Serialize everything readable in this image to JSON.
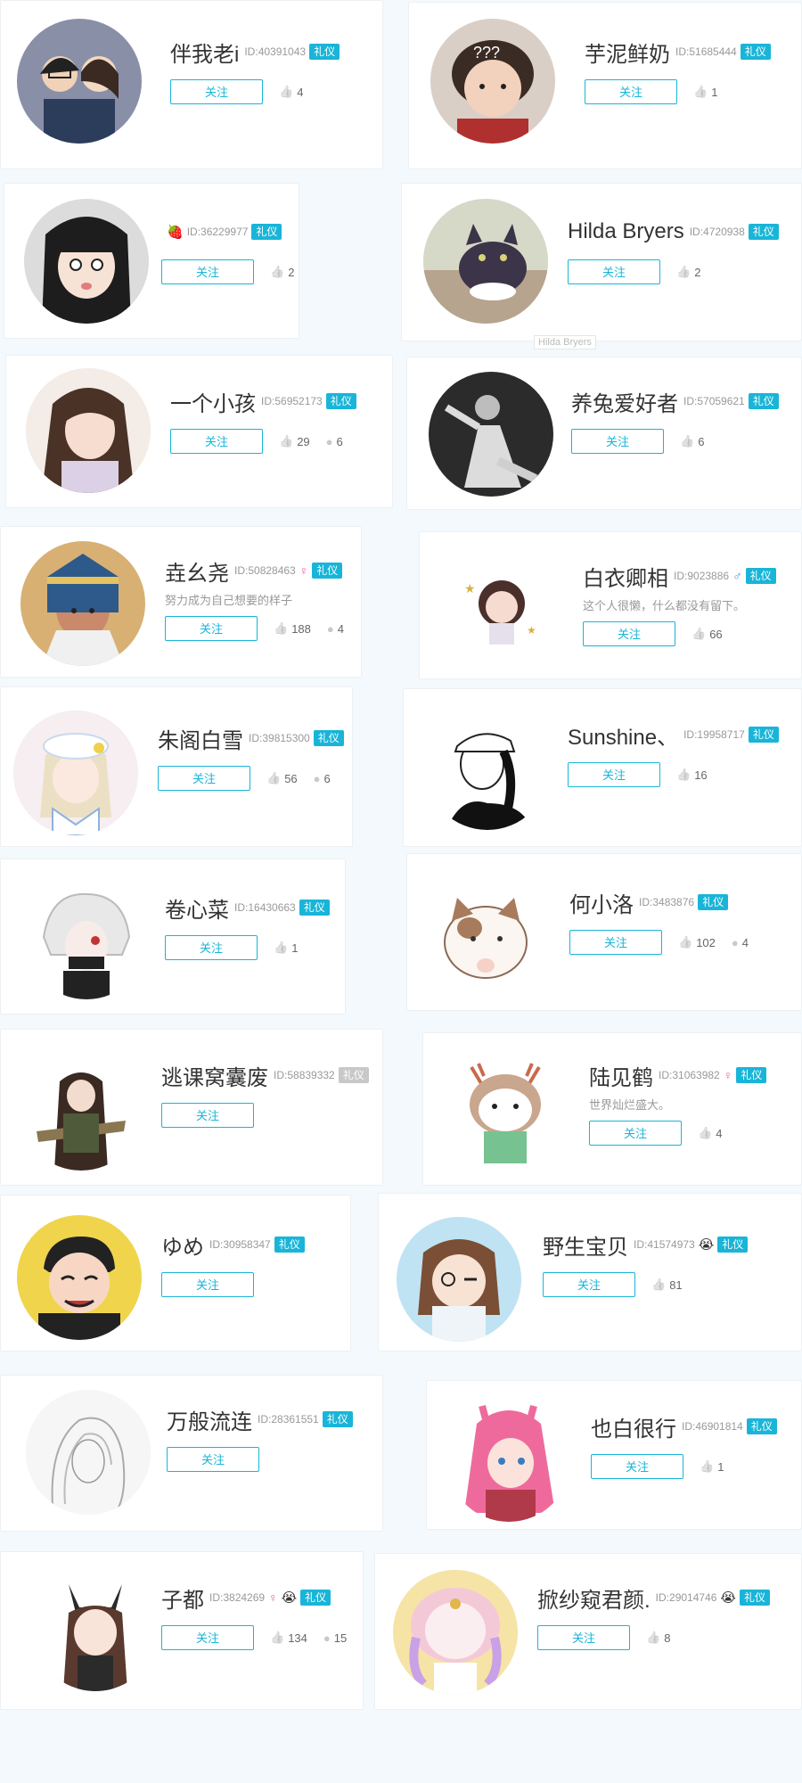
{
  "labels": {
    "follow": "关注",
    "id_prefix": "ID:"
  },
  "colors": {
    "accent": "#19b5d8",
    "badge_disabled": "#c8c8c8",
    "female": "#f15b9b",
    "male": "#3b8ee0"
  },
  "users": [
    {
      "name": "伴我老i",
      "id": "40391043",
      "badge": "礼仪",
      "likes": "4",
      "comments": null,
      "motto": null,
      "gender": null,
      "emoji": null,
      "avatar": "photo-couple"
    },
    {
      "name": "芋泥鲜奶",
      "id": "51685444",
      "badge": "礼仪",
      "likes": "1",
      "comments": null,
      "motto": null,
      "gender": null,
      "emoji": null,
      "avatar": "photo-baby"
    },
    {
      "name": "",
      "id": "36229977",
      "badge": "礼仪",
      "likes": "2",
      "comments": null,
      "motto": null,
      "gender": null,
      "emoji": "🍓",
      "avatar": "anime-black-hair"
    },
    {
      "name": "Hilda Bryers",
      "id": "4720938",
      "badge": "礼仪",
      "likes": "2",
      "comments": null,
      "motto": null,
      "gender": null,
      "emoji": null,
      "avatar": "photo-cat",
      "tooltip": "Hilda Bryers"
    },
    {
      "name": "一个小孩",
      "id": "56952173",
      "badge": "礼仪",
      "likes": "29",
      "comments": "6",
      "motto": null,
      "gender": null,
      "emoji": null,
      "avatar": "anime-brown-hair"
    },
    {
      "name": "养兔爱好者",
      "id": "57059621",
      "badge": "礼仪",
      "likes": "6",
      "comments": null,
      "motto": null,
      "gender": null,
      "emoji": null,
      "avatar": "photo-bw-person"
    },
    {
      "name": "垚幺尧",
      "id": "50828463",
      "badge": "礼仪",
      "likes": "188",
      "comments": "4",
      "motto": "努力成为自己想要的样子",
      "gender": "female",
      "emoji": null,
      "avatar": "anime-egyptian"
    },
    {
      "name": "白衣卿相",
      "id": "9023886",
      "badge": "礼仪",
      "likes": "66",
      "comments": null,
      "motto": "这个人很懒，什么都没有留下。",
      "gender": "male",
      "emoji": null,
      "avatar": "anime-small-girl"
    },
    {
      "name": "朱阁白雪",
      "id": "39815300",
      "badge": "礼仪",
      "likes": "56",
      "comments": "6",
      "motto": null,
      "gender": null,
      "emoji": null,
      "avatar": "anime-sailor"
    },
    {
      "name": "Sunshine、",
      "id": "19958717",
      "badge": "礼仪",
      "likes": "16",
      "comments": null,
      "motto": null,
      "gender": null,
      "emoji": null,
      "avatar": "sketch-cap"
    },
    {
      "name": "卷心菜",
      "id": "16430663",
      "badge": "礼仪",
      "likes": "1",
      "comments": null,
      "motto": null,
      "gender": null,
      "emoji": null,
      "avatar": "anime-white-hair"
    },
    {
      "name": "何小洛",
      "id": "3483876",
      "badge": "礼仪",
      "likes": "102",
      "comments": "4",
      "motto": null,
      "gender": null,
      "emoji": null,
      "avatar": "cartoon-cat"
    },
    {
      "name": "逃课窝囊废",
      "id": "58839332",
      "badge": "礼仪",
      "badge_disabled": true,
      "likes": null,
      "comments": null,
      "motto": null,
      "gender": null,
      "emoji": null,
      "avatar": "anime-soldier"
    },
    {
      "name": "陆见鹤",
      "id": "31063982",
      "badge": "礼仪",
      "likes": "4",
      "comments": null,
      "motto": "世界灿烂盛大。",
      "gender": "female",
      "emoji": null,
      "avatar": "cartoon-deer"
    },
    {
      "name": "ゆめ",
      "id": "30958347",
      "badge": "礼仪",
      "likes": null,
      "comments": null,
      "motto": null,
      "gender": null,
      "emoji": null,
      "avatar": "cartoon-man"
    },
    {
      "name": "野生宝贝",
      "id": "41574973",
      "badge": "礼仪",
      "likes": "81",
      "comments": null,
      "motto": null,
      "gender": null,
      "emoji": "😭",
      "avatar": "anime-wink"
    },
    {
      "name": "万般流连",
      "id": "28361551",
      "badge": "礼仪",
      "likes": null,
      "comments": null,
      "motto": null,
      "gender": null,
      "emoji": null,
      "avatar": "sketch-longhair"
    },
    {
      "name": "也白很行",
      "id": "46901814",
      "badge": "礼仪",
      "likes": "1",
      "comments": null,
      "motto": null,
      "gender": null,
      "emoji": null,
      "avatar": "anime-pink-hair"
    },
    {
      "name": "子都",
      "id": "3824269",
      "badge": "礼仪",
      "likes": "134",
      "comments": "15",
      "motto": null,
      "gender": "female",
      "emoji": "😭",
      "avatar": "anime-catgirl"
    },
    {
      "name": "掀纱窥君颜.",
      "id": "29014746",
      "badge": "礼仪",
      "likes": "8",
      "comments": null,
      "motto": null,
      "gender": null,
      "emoji": "😭",
      "avatar": "anime-pastel"
    }
  ]
}
